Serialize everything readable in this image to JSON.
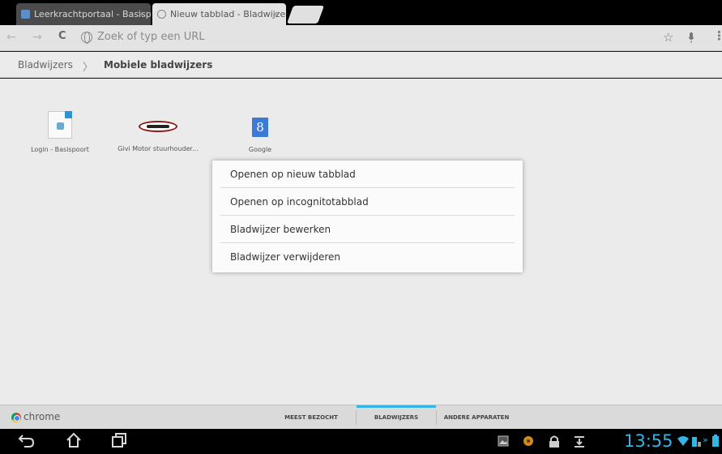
{
  "tabs": [
    {
      "title": "Leerkrachtportaal - Basisp",
      "close": "×",
      "active": false
    },
    {
      "title": "Nieuw tabblad - Bladwijze",
      "close": "×",
      "active": true
    }
  ],
  "toolbar": {
    "back": "←",
    "forward": "→",
    "reload": "C",
    "omnibox_placeholder": "Zoek of typ een URL",
    "star": "☆",
    "mic": "🎙",
    "menu": "⋮"
  },
  "breadcrumb": {
    "root": "Bladwijzers",
    "separator": "〉",
    "current": "Mobiele bladwijzers"
  },
  "bookmarks": [
    {
      "label": "Login - Basispoort",
      "icon": "document-icon"
    },
    {
      "label": "Givi Motor stuurhouder...",
      "icon": "motor-logo-icon"
    },
    {
      "label": "Google",
      "icon": "google-icon",
      "glyph": "8"
    }
  ],
  "context_menu": {
    "items": [
      "Openen op nieuw tabblad",
      "Openen op incognitotabblad",
      "Bladwijzer bewerken",
      "Bladwijzer verwijderen"
    ]
  },
  "bottom_bar": {
    "brand": "chrome",
    "tabs": [
      {
        "label": "MEEST BEZOCHT",
        "active": false
      },
      {
        "label": "BLADWIJZERS",
        "active": true
      },
      {
        "label": "ANDERE APPARATEN",
        "active": false
      }
    ]
  },
  "system_bar": {
    "back": "⮌",
    "home": "⌂",
    "recents": "❐",
    "clock": "13:55",
    "status_icons": [
      "gallery-icon",
      "app-icon",
      "lock-icon",
      "download-icon",
      "wifi-icon",
      "battery-icon"
    ]
  },
  "colors": {
    "accent": "#33b5e5",
    "background": "#ebebeb",
    "menu_background": "#fbfbfb"
  }
}
